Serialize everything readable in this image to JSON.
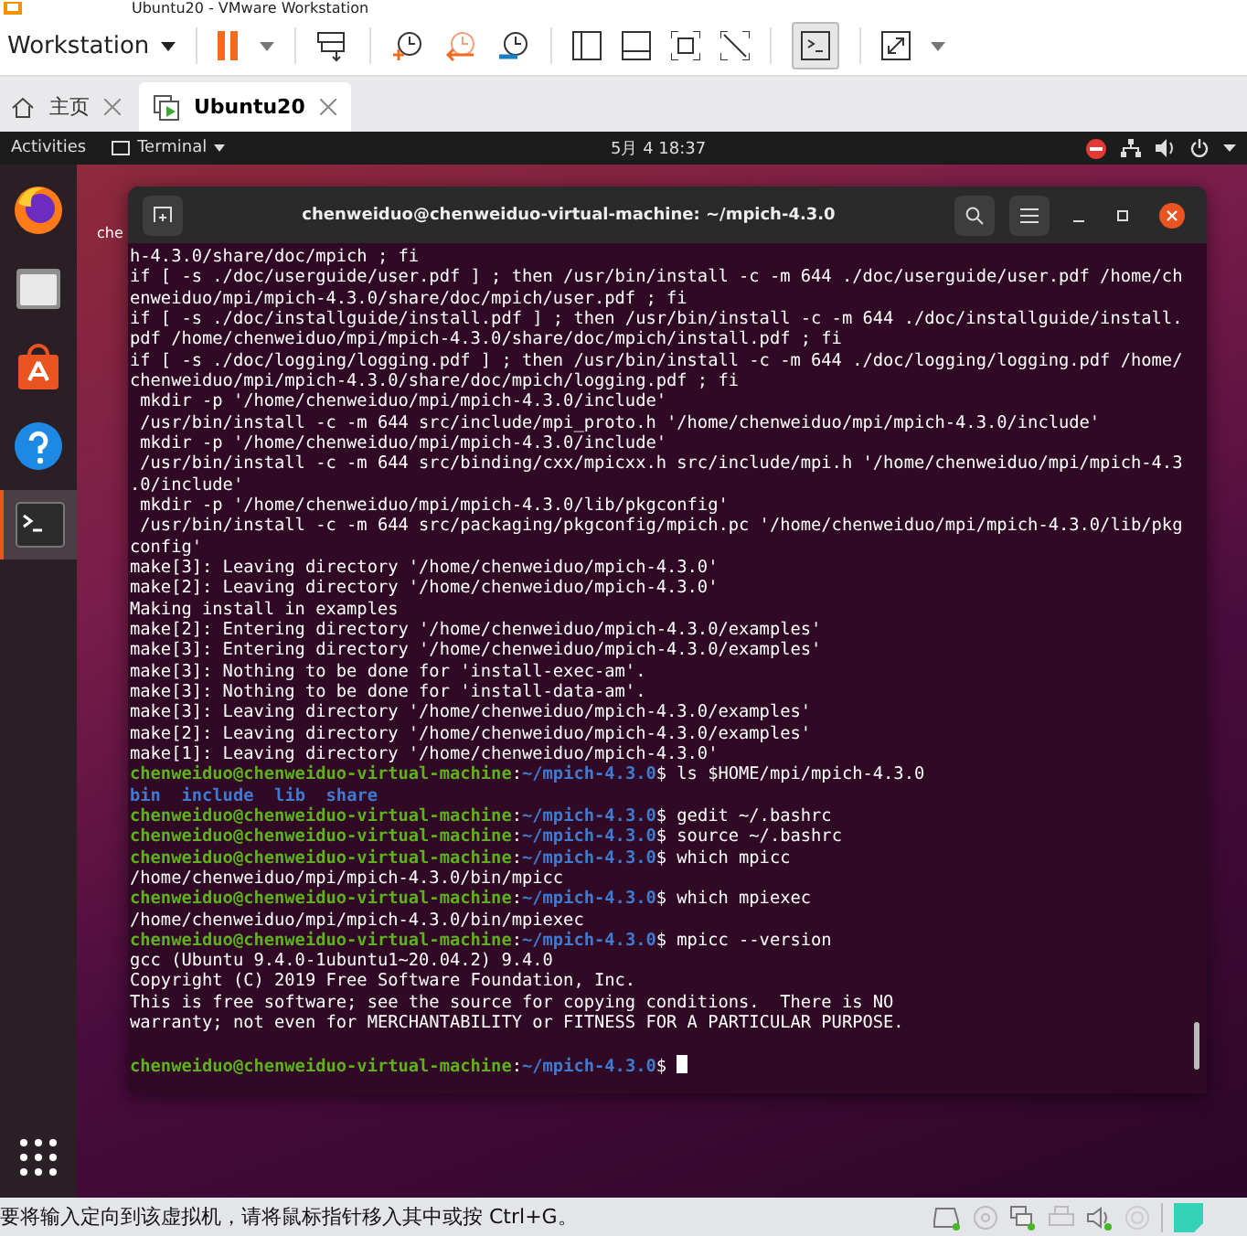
{
  "window": {
    "title": "Ubuntu20 - VMware Workstation"
  },
  "toolbar": {
    "menu": "Workstation"
  },
  "tabs": [
    {
      "label": "主页",
      "selected": false
    },
    {
      "label": "Ubuntu20",
      "selected": true
    }
  ],
  "top_bar": {
    "activities": "Activities",
    "app_menu": "Terminal",
    "clock": "5月 4  18:37"
  },
  "desktop": {
    "icon_label": "che"
  },
  "dock": {
    "items": [
      {
        "kind": "firefox",
        "selected": false
      },
      {
        "kind": "files",
        "selected": false
      },
      {
        "kind": "software",
        "selected": false
      },
      {
        "kind": "help",
        "selected": false
      },
      {
        "kind": "terminal",
        "selected": true
      }
    ]
  },
  "terminal": {
    "title": "chenweiduo@chenweiduo-virtual-machine: ~/mpich-4.3.0",
    "lines": [
      {
        "kind": "output",
        "text": "h-4.3.0/share/doc/mpich ; fi"
      },
      {
        "kind": "output",
        "text": "if [ -s ./doc/userguide/user.pdf ] ; then /usr/bin/install -c -m 644 ./doc/userguide/user.pdf /home/ch"
      },
      {
        "kind": "output",
        "text": "enweiduo/mpi/mpich-4.3.0/share/doc/mpich/user.pdf ; fi"
      },
      {
        "kind": "output",
        "text": "if [ -s ./doc/installguide/install.pdf ] ; then /usr/bin/install -c -m 644 ./doc/installguide/install."
      },
      {
        "kind": "output",
        "text": "pdf /home/chenweiduo/mpi/mpich-4.3.0/share/doc/mpich/install.pdf ; fi"
      },
      {
        "kind": "output",
        "text": "if [ -s ./doc/logging/logging.pdf ] ; then /usr/bin/install -c -m 644 ./doc/logging/logging.pdf /home/"
      },
      {
        "kind": "output",
        "text": "chenweiduo/mpi/mpich-4.3.0/share/doc/mpich/logging.pdf ; fi"
      },
      {
        "kind": "output",
        "text": " mkdir -p '/home/chenweiduo/mpi/mpich-4.3.0/include'"
      },
      {
        "kind": "output",
        "text": " /usr/bin/install -c -m 644 src/include/mpi_proto.h '/home/chenweiduo/mpi/mpich-4.3.0/include'"
      },
      {
        "kind": "output",
        "text": " mkdir -p '/home/chenweiduo/mpi/mpich-4.3.0/include'"
      },
      {
        "kind": "output",
        "text": " /usr/bin/install -c -m 644 src/binding/cxx/mpicxx.h src/include/mpi.h '/home/chenweiduo/mpi/mpich-4.3"
      },
      {
        "kind": "output",
        "text": ".0/include'"
      },
      {
        "kind": "output",
        "text": " mkdir -p '/home/chenweiduo/mpi/mpich-4.3.0/lib/pkgconfig'"
      },
      {
        "kind": "output",
        "text": " /usr/bin/install -c -m 644 src/packaging/pkgconfig/mpich.pc '/home/chenweiduo/mpi/mpich-4.3.0/lib/pkg"
      },
      {
        "kind": "output",
        "text": "config'"
      },
      {
        "kind": "output",
        "text": "make[3]: Leaving directory '/home/chenweiduo/mpich-4.3.0'"
      },
      {
        "kind": "output",
        "text": "make[2]: Leaving directory '/home/chenweiduo/mpich-4.3.0'"
      },
      {
        "kind": "output",
        "text": "Making install in examples"
      },
      {
        "kind": "output",
        "text": "make[2]: Entering directory '/home/chenweiduo/mpich-4.3.0/examples'"
      },
      {
        "kind": "output",
        "text": "make[3]: Entering directory '/home/chenweiduo/mpich-4.3.0/examples'"
      },
      {
        "kind": "output",
        "text": "make[3]: Nothing to be done for 'install-exec-am'."
      },
      {
        "kind": "output",
        "text": "make[3]: Nothing to be done for 'install-data-am'."
      },
      {
        "kind": "output",
        "text": "make[3]: Leaving directory '/home/chenweiduo/mpich-4.3.0/examples'"
      },
      {
        "kind": "output",
        "text": "make[2]: Leaving directory '/home/chenweiduo/mpich-4.3.0/examples'"
      },
      {
        "kind": "output",
        "text": "make[1]: Leaving directory '/home/chenweiduo/mpich-4.3.0'"
      },
      {
        "kind": "prompt",
        "user": "chenweiduo@chenweiduo-virtual-machine",
        "colon": ":",
        "path": "~/mpich-4.3.0",
        "sign": "$",
        "command": "ls $HOME/mpi/mpich-4.3.0"
      },
      {
        "kind": "listing",
        "items": [
          "bin",
          "include",
          "lib",
          "share"
        ]
      },
      {
        "kind": "prompt",
        "user": "chenweiduo@chenweiduo-virtual-machine",
        "colon": ":",
        "path": "~/mpich-4.3.0",
        "sign": "$",
        "command": "gedit ~/.bashrc"
      },
      {
        "kind": "prompt",
        "user": "chenweiduo@chenweiduo-virtual-machine",
        "colon": ":",
        "path": "~/mpich-4.3.0",
        "sign": "$",
        "command": "source ~/.bashrc"
      },
      {
        "kind": "prompt",
        "user": "chenweiduo@chenweiduo-virtual-machine",
        "colon": ":",
        "path": "~/mpich-4.3.0",
        "sign": "$",
        "command": "which mpicc"
      },
      {
        "kind": "output",
        "text": "/home/chenweiduo/mpi/mpich-4.3.0/bin/mpicc"
      },
      {
        "kind": "prompt",
        "user": "chenweiduo@chenweiduo-virtual-machine",
        "colon": ":",
        "path": "~/mpich-4.3.0",
        "sign": "$",
        "command": "which mpiexec"
      },
      {
        "kind": "output",
        "text": "/home/chenweiduo/mpi/mpich-4.3.0/bin/mpiexec"
      },
      {
        "kind": "prompt",
        "user": "chenweiduo@chenweiduo-virtual-machine",
        "colon": ":",
        "path": "~/mpich-4.3.0",
        "sign": "$",
        "command": "mpicc --version"
      },
      {
        "kind": "output",
        "text": "gcc (Ubuntu 9.4.0-1ubuntu1~20.04.2) 9.4.0"
      },
      {
        "kind": "output",
        "text": "Copyright (C) 2019 Free Software Foundation, Inc."
      },
      {
        "kind": "output",
        "text": "This is free software; see the source for copying conditions.  There is NO"
      },
      {
        "kind": "output",
        "text": "warranty; not even for MERCHANTABILITY or FITNESS FOR A PARTICULAR PURPOSE."
      },
      {
        "kind": "blank"
      },
      {
        "kind": "prompt",
        "user": "chenweiduo@chenweiduo-virtual-machine",
        "colon": ":",
        "path": "~/mpich-4.3.0",
        "sign": "$",
        "cursor": true
      }
    ]
  },
  "status_bar": {
    "message": "要将输入定向到该虚拟机，请将鼠标指针移入其中或按 Ctrl+G。"
  }
}
